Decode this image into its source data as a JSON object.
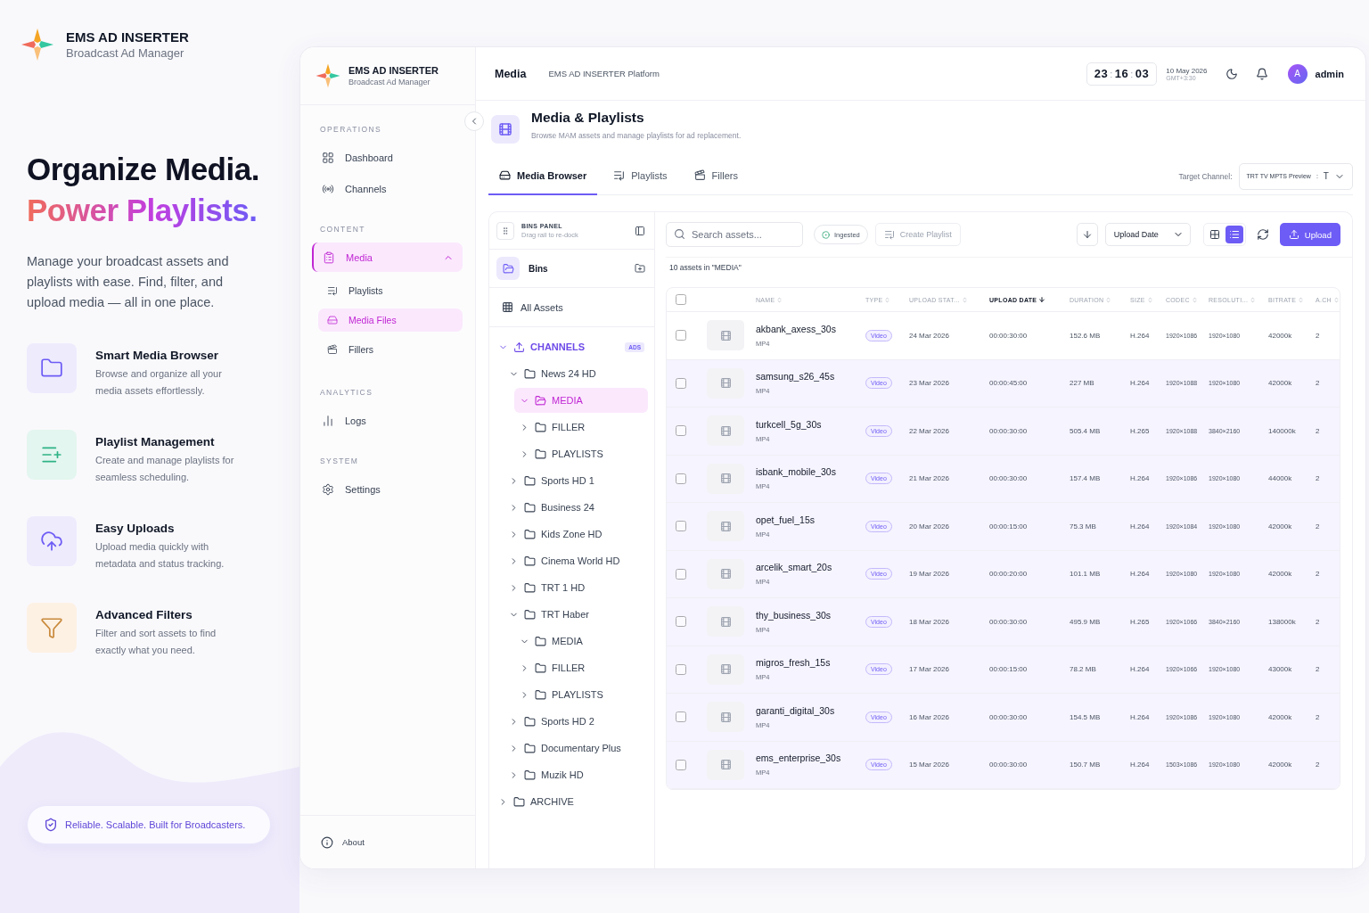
{
  "brand": {
    "title": "EMS AD INSERTER",
    "subtitle": "Broadcast Ad Manager"
  },
  "hero": {
    "line1": "Organize Media.",
    "line2": "Power Playlists.",
    "description": "Manage your broadcast assets and playlists with ease. Find, filter, and upload media — all in one place."
  },
  "features": [
    {
      "kind": "folder",
      "title": "Smart Media Browser",
      "description": "Browse and organize all your media assets effortlessly."
    },
    {
      "kind": "playlist",
      "title": "Playlist Management",
      "description": "Create and manage playlists for seamless scheduling."
    },
    {
      "kind": "upload",
      "title": "Easy Uploads",
      "description": "Upload media quickly with metadata and status tracking."
    },
    {
      "kind": "filter",
      "title": "Advanced Filters",
      "description": "Filter and sort assets to find exactly what you need."
    }
  ],
  "tagline": "Reliable. Scalable. Built for Broadcasters.",
  "sidebar": {
    "brand": {
      "title": "EMS AD INSERTER",
      "subtitle": "Broadcast Ad Manager"
    },
    "sections": [
      {
        "heading": "OPERATIONS",
        "items": [
          {
            "kind": "dashboard",
            "label": "Dashboard",
            "selected": false
          },
          {
            "kind": "channels",
            "label": "Channels",
            "selected": false
          }
        ]
      },
      {
        "heading": "CONTENT",
        "items": [
          {
            "kind": "media",
            "label": "Media",
            "selected": true,
            "expanded": true,
            "children": [
              {
                "kind": "playlist",
                "label": "Playlists",
                "selected": false
              },
              {
                "kind": "files",
                "label": "Media Files",
                "selected": true
              },
              {
                "kind": "fillers",
                "label": "Fillers",
                "selected": false
              }
            ]
          }
        ]
      },
      {
        "heading": "ANALYTICS",
        "items": [
          {
            "kind": "logs",
            "label": "Logs",
            "selected": false
          }
        ]
      },
      {
        "heading": "SYSTEM",
        "items": [
          {
            "kind": "settings",
            "label": "Settings",
            "selected": false
          }
        ]
      }
    ],
    "about": "About"
  },
  "topbar": {
    "title": "Media",
    "platform": "EMS AD INSERTER Platform",
    "clock": [
      "23",
      ":",
      "16",
      ":",
      "03"
    ],
    "date": "10 May 2026",
    "timezone": "GMT+3:30",
    "avatar": "A",
    "user": "admin"
  },
  "page": {
    "title": "Media & Playlists",
    "subtitle": "Browse MAM assets and manage playlists for ad replacement."
  },
  "tabs": [
    {
      "kind": "browser",
      "label": "Media Browser",
      "selected": true
    },
    {
      "kind": "playlist",
      "label": "Playlists",
      "selected": false
    },
    {
      "kind": "fillers",
      "label": "Fillers",
      "selected": false
    }
  ],
  "target_channel": {
    "label": "Target Channel:",
    "value": "TRT TV MPTS Preview",
    "separator": ":",
    "suffix": "T"
  },
  "bins": {
    "title": "BINS PANEL",
    "hint": "Drag rail to re-dock",
    "bins_label": "Bins",
    "all_assets": "All Assets",
    "tree": [
      {
        "kind": "group",
        "label": "CHANNELS",
        "badge": "ADS",
        "expanded": true,
        "selected": false,
        "children": [
          {
            "kind": "folder",
            "label": "News 24 HD",
            "expanded": true,
            "selected": false,
            "children": [
              {
                "kind": "folder",
                "label": "MEDIA",
                "expanded": true,
                "selected": true
              },
              {
                "kind": "folder",
                "label": "FILLER",
                "expanded": false,
                "selected": false
              },
              {
                "kind": "folder",
                "label": "PLAYLISTS",
                "expanded": false,
                "selected": false
              }
            ]
          },
          {
            "kind": "folder",
            "label": "Sports HD 1",
            "expanded": false,
            "selected": false
          },
          {
            "kind": "folder",
            "label": "Business 24",
            "expanded": false,
            "selected": false
          },
          {
            "kind": "folder",
            "label": "Kids Zone HD",
            "expanded": false,
            "selected": false
          },
          {
            "kind": "folder",
            "label": "Cinema World HD",
            "expanded": false,
            "selected": false
          },
          {
            "kind": "folder",
            "label": "TRT 1 HD",
            "expanded": false,
            "selected": false
          },
          {
            "kind": "folder",
            "label": "TRT Haber",
            "expanded": true,
            "selected": false,
            "children": [
              {
                "kind": "folder",
                "label": "MEDIA",
                "expanded": true,
                "selected": false
              },
              {
                "kind": "folder",
                "label": "FILLER",
                "expanded": false,
                "selected": false
              },
              {
                "kind": "folder",
                "label": "PLAYLISTS",
                "expanded": false,
                "selected": false
              }
            ]
          },
          {
            "kind": "folder",
            "label": "Sports HD 2",
            "expanded": false,
            "selected": false
          },
          {
            "kind": "folder",
            "label": "Documentary Plus",
            "expanded": false,
            "selected": false
          },
          {
            "kind": "folder",
            "label": "Muzik HD",
            "expanded": false,
            "selected": false
          }
        ]
      },
      {
        "kind": "folder",
        "label": "ARCHIVE",
        "expanded": false,
        "selected": false
      }
    ]
  },
  "toolbar": {
    "search_placeholder": "Search assets...",
    "ingested": "Ingested",
    "create_playlist": {
      "label": "Create Playlist",
      "disabled": true
    },
    "sort_field": "Upload Date",
    "views": [
      {
        "kind": "grid",
        "selected": false
      },
      {
        "kind": "list",
        "selected": true
      }
    ],
    "upload": "Upload"
  },
  "count": "10 assets in \"MEDIA\"",
  "table": {
    "all_checked": false,
    "columns": [
      {
        "label": "NAME",
        "sorted": false
      },
      {
        "label": "TYPE",
        "sorted": false
      },
      {
        "label": "UPLOAD STAT...",
        "sorted": false
      },
      {
        "label": "UPLOAD DATE",
        "sorted": true
      },
      {
        "label": "DURATION",
        "sorted": false
      },
      {
        "label": "SIZE",
        "sorted": false
      },
      {
        "label": "CODEC",
        "sorted": false
      },
      {
        "label": "RESOLUTI...",
        "sorted": false
      },
      {
        "label": "BITRATE",
        "sorted": false
      },
      {
        "label": "A.CH",
        "sorted": false
      }
    ],
    "rows": [
      {
        "checked": false,
        "cells": [
          "akbank_axess_30s",
          "Video",
          "24 Mar 2026",
          "00:00:30:00",
          "152.6 MB",
          "H.264",
          "1920×1086",
          "1920×1080",
          "42000k",
          "2"
        ],
        "format": "MP4"
      },
      {
        "checked": false,
        "cells": [
          "samsung_s26_45s",
          "Video",
          "23 Mar 2026",
          "00:00:45:00",
          "227 MB",
          "H.264",
          "1920×1088",
          "1920×1080",
          "42000k",
          "2"
        ],
        "format": "MP4"
      },
      {
        "checked": false,
        "cells": [
          "turkcell_5g_30s",
          "Video",
          "22 Mar 2026",
          "00:00:30:00",
          "505.4 MB",
          "H.265",
          "1920×1088",
          "3840×2160",
          "140000k",
          "2"
        ],
        "format": "MP4"
      },
      {
        "checked": false,
        "cells": [
          "isbank_mobile_30s",
          "Video",
          "21 Mar 2026",
          "00:00:30:00",
          "157.4 MB",
          "H.264",
          "1920×1086",
          "1920×1080",
          "44000k",
          "2"
        ],
        "format": "MP4"
      },
      {
        "checked": false,
        "cells": [
          "opet_fuel_15s",
          "Video",
          "20 Mar 2026",
          "00:00:15:00",
          "75.3 MB",
          "H.264",
          "1920×1084",
          "1920×1080",
          "42000k",
          "2"
        ],
        "format": "MP4"
      },
      {
        "checked": false,
        "cells": [
          "arcelik_smart_20s",
          "Video",
          "19 Mar 2026",
          "00:00:20:00",
          "101.1 MB",
          "H.264",
          "1920×1080",
          "1920×1080",
          "42000k",
          "2"
        ],
        "format": "MP4"
      },
      {
        "checked": false,
        "cells": [
          "thy_business_30s",
          "Video",
          "18 Mar 2026",
          "00:00:30:00",
          "495.9 MB",
          "H.265",
          "1920×1066",
          "3840×2160",
          "138000k",
          "2"
        ],
        "format": "MP4"
      },
      {
        "checked": false,
        "cells": [
          "migros_fresh_15s",
          "Video",
          "17 Mar 2026",
          "00:00:15:00",
          "78.2 MB",
          "H.264",
          "1920×1066",
          "1920×1080",
          "43000k",
          "2"
        ],
        "format": "MP4"
      },
      {
        "checked": false,
        "cells": [
          "garanti_digital_30s",
          "Video",
          "16 Mar 2026",
          "00:00:30:00",
          "154.5 MB",
          "H.264",
          "1920×1086",
          "1920×1080",
          "42000k",
          "2"
        ],
        "format": "MP4"
      },
      {
        "checked": false,
        "cells": [
          "ems_enterprise_30s",
          "Video",
          "15 Mar 2026",
          "00:00:30:00",
          "150.7 MB",
          "H.264",
          "1503×1086",
          "1920×1080",
          "42000k",
          "2"
        ],
        "format": "MP4"
      }
    ]
  }
}
